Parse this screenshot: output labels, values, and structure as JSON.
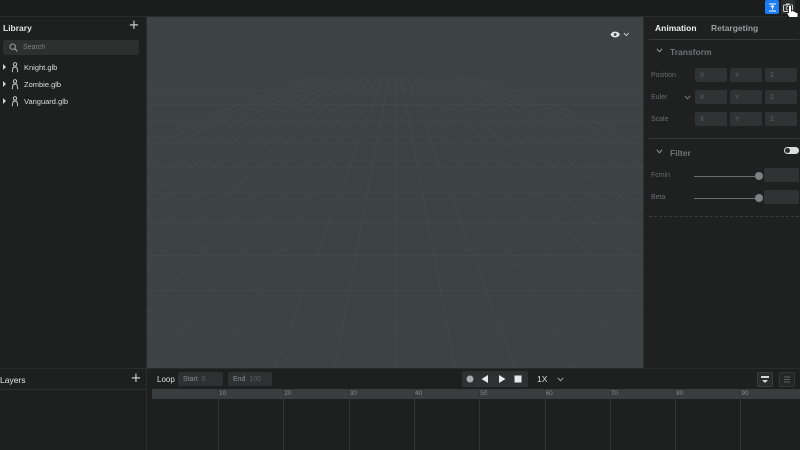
{
  "top_bar": {
    "right_buttons": [
      {
        "icon": "fit-icon",
        "accent": "#1c7cf5"
      },
      {
        "icon": "camera-icon"
      }
    ]
  },
  "library": {
    "title": "Library",
    "add_icon": "plus-icon",
    "search": {
      "placeholder": "Search",
      "value": ""
    },
    "files": [
      {
        "name": "Knight.glb"
      },
      {
        "name": "Zombie.glb"
      },
      {
        "name": "Vanguard.glb"
      }
    ]
  },
  "viewport": {
    "background": "#3d4242",
    "visibility_icon": "eye-icon"
  },
  "inspector": {
    "tabs": [
      {
        "label": "Animation",
        "active": true
      },
      {
        "label": "Retargeting",
        "active": false
      }
    ],
    "transform": {
      "title": "Transform",
      "rows": [
        {
          "label": "Position",
          "fields": [
            "X",
            "Y",
            "Z"
          ]
        },
        {
          "label": "Euler",
          "fields": [
            "X",
            "Y",
            "Z"
          ]
        },
        {
          "label": "Scale",
          "fields": [
            "X",
            "Y",
            "Z"
          ]
        }
      ]
    },
    "filter": {
      "title": "Filter",
      "enabled": false,
      "rows": [
        {
          "label": "Fcmin"
        },
        {
          "label": "Beta"
        }
      ]
    }
  },
  "layers": {
    "title": "Layers",
    "add_icon": "plus-icon"
  },
  "timeline": {
    "loop_label": "Loop",
    "start": {
      "label": "Start",
      "value": "0"
    },
    "end": {
      "label": "End",
      "value": "100"
    },
    "speed": "1X",
    "ruler_ticks": [
      "10",
      "20",
      "30",
      "40",
      "50",
      "60",
      "70",
      "80",
      "90"
    ]
  }
}
